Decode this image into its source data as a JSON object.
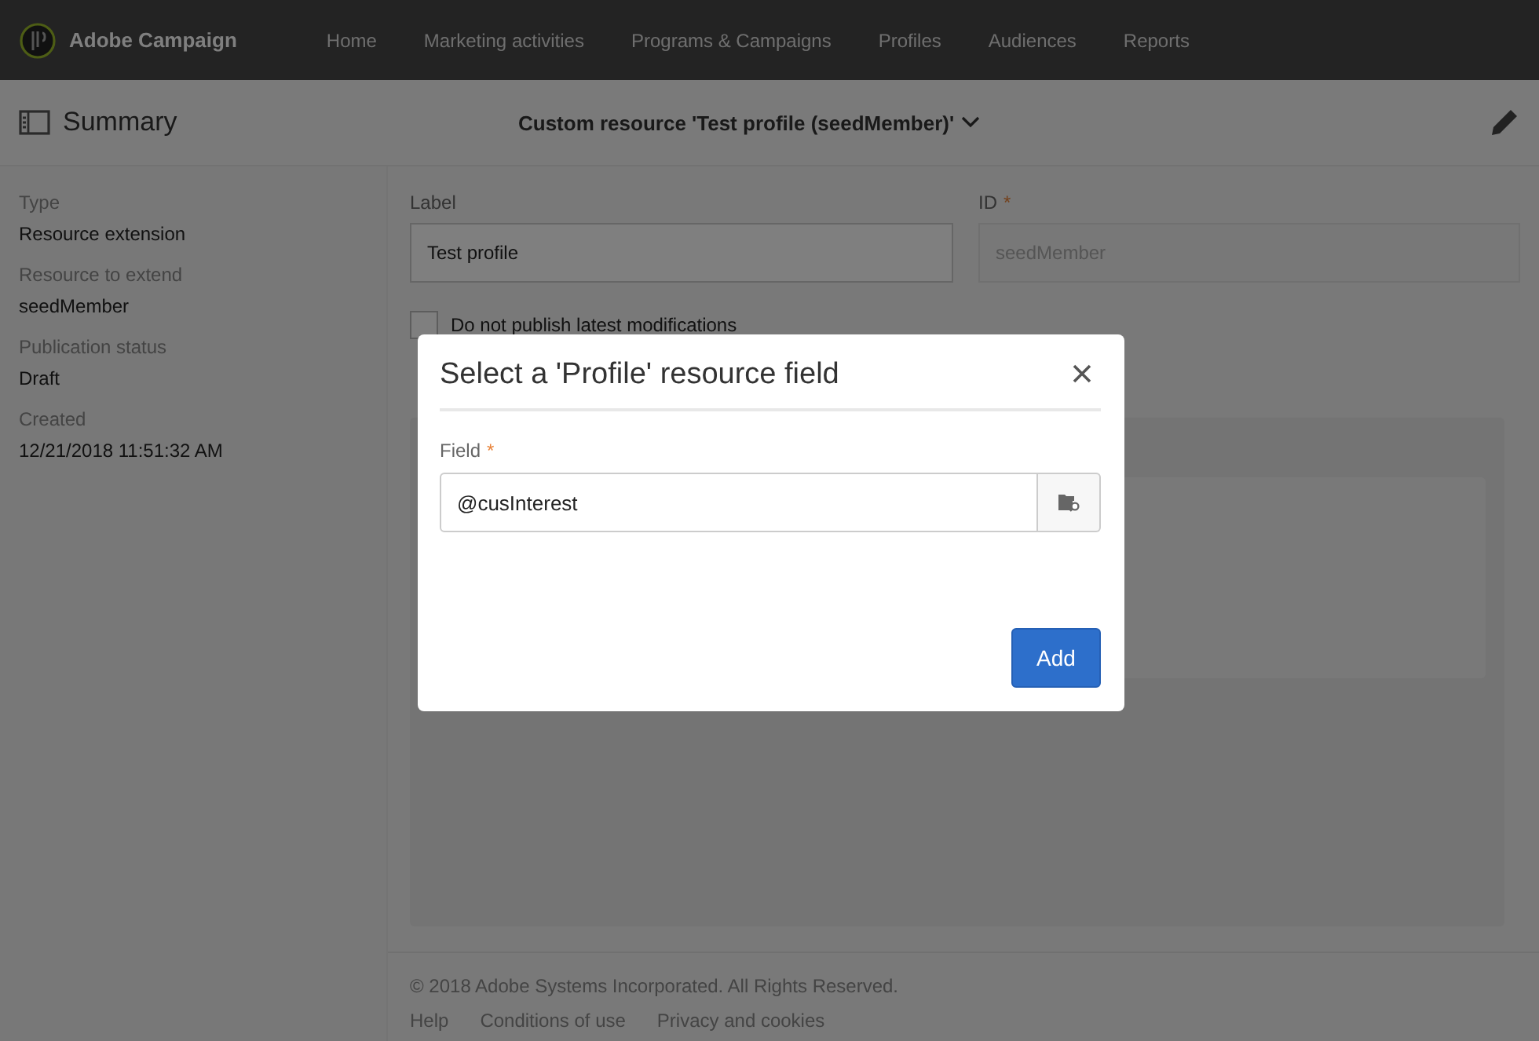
{
  "app": {
    "name": "Adobe Campaign"
  },
  "nav": [
    {
      "label": "Home"
    },
    {
      "label": "Marketing activities"
    },
    {
      "label": "Programs & Campaigns"
    },
    {
      "label": "Profiles"
    },
    {
      "label": "Audiences"
    },
    {
      "label": "Reports"
    }
  ],
  "subheader": {
    "summary": "Summary",
    "title": "Custom resource 'Test profile (seedMember)'"
  },
  "summary": [
    {
      "label": "Type",
      "value": "Resource extension"
    },
    {
      "label": "Resource to extend",
      "value": "seedMember"
    },
    {
      "label": "Publication status",
      "value": "Draft"
    },
    {
      "label": "Created",
      "value": "12/21/2018 11:51:32 AM"
    }
  ],
  "form": {
    "label_field": {
      "label": "Label",
      "value": "Test profile"
    },
    "id_field": {
      "label": "ID",
      "required_mark": "*",
      "value": "seedMember",
      "disabled": true
    },
    "publish_checkbox": {
      "label": "Do not publish latest modifications",
      "checked": false
    }
  },
  "footer": {
    "copyright": "© 2018 Adobe Systems Incorporated. All Rights Reserved.",
    "links": [
      "Help",
      "Conditions of use",
      "Privacy and cookies"
    ]
  },
  "dialog": {
    "title": "Select a 'Profile' resource field",
    "field": {
      "label": "Field",
      "required_mark": "*",
      "value": "@cusInterest"
    },
    "button": "Add"
  }
}
